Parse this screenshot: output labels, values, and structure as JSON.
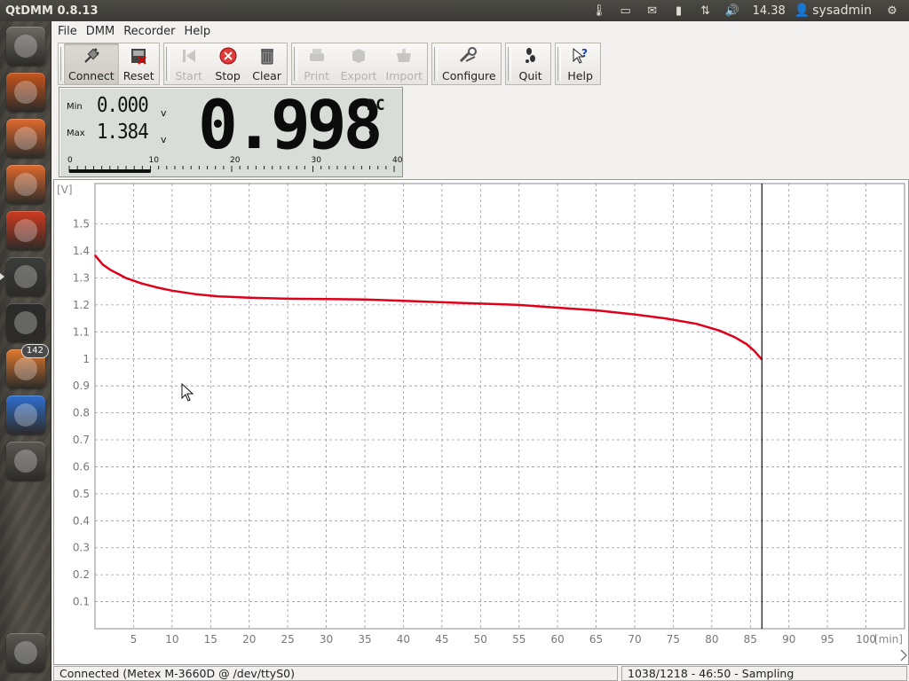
{
  "topbar": {
    "app_title": "QtDMM 0.8.13",
    "clock": "14.38",
    "user": "sysadmin"
  },
  "launcher": {
    "items": [
      {
        "name": "dash-home",
        "color": "#6d6a63"
      },
      {
        "name": "firefox",
        "color": "#c8551c"
      },
      {
        "name": "files",
        "color": "#e06a2d"
      },
      {
        "name": "software-center",
        "color": "#e06a2d"
      },
      {
        "name": "system-settings",
        "color": "#d03a1e"
      },
      {
        "name": "qtdmm",
        "color": "#3b3d3a"
      },
      {
        "name": "terminal",
        "color": "#2b2b2b"
      },
      {
        "name": "update-manager",
        "color": "#e0782d",
        "badge": "142"
      },
      {
        "name": "chromium",
        "color": "#2e6fd0"
      },
      {
        "name": "workspace-switcher",
        "color": "#5a5852"
      },
      {
        "name": "trash",
        "color": "#5a5852"
      }
    ]
  },
  "menu": [
    "File",
    "DMM",
    "Recorder",
    "Help"
  ],
  "toolbar": {
    "groups": [
      [
        {
          "label": "Connect",
          "icon": "plug-icon",
          "state": "pressed"
        },
        {
          "label": "Reset",
          "icon": "reset-icon",
          "state": "normal"
        }
      ],
      [
        {
          "label": "Start",
          "icon": "start-icon",
          "state": "disabled"
        },
        {
          "label": "Stop",
          "icon": "stop-icon",
          "state": "normal"
        },
        {
          "label": "Clear",
          "icon": "trash-icon",
          "state": "normal"
        }
      ],
      [
        {
          "label": "Print",
          "icon": "print-icon",
          "state": "disabled"
        },
        {
          "label": "Export",
          "icon": "export-icon",
          "state": "disabled"
        },
        {
          "label": "Import",
          "icon": "import-icon",
          "state": "disabled"
        }
      ],
      [
        {
          "label": "Configure",
          "icon": "wrench-icon",
          "state": "normal"
        }
      ],
      [
        {
          "label": "Quit",
          "icon": "quit-icon",
          "state": "normal"
        }
      ],
      [
        {
          "label": "Help",
          "icon": "help-icon",
          "state": "normal"
        }
      ]
    ]
  },
  "display": {
    "min_label": "Min",
    "min_value": "0.000",
    "min_unit": "V",
    "max_label": "Max",
    "max_value": "1.384",
    "max_unit": "V",
    "value": "0.998",
    "mode": "DC",
    "unit": "V",
    "bar_scale": [
      "0",
      "10",
      "20",
      "30",
      "40"
    ],
    "bar_fill_fraction": 0.25
  },
  "chart_data": {
    "type": "line",
    "xlabel": "[min]",
    "ylabel": "[V]",
    "xlim": [
      0,
      105
    ],
    "ylim": [
      0,
      1.65
    ],
    "x_ticks": [
      5,
      10,
      15,
      20,
      25,
      30,
      35,
      40,
      45,
      50,
      55,
      60,
      65,
      70,
      75,
      80,
      85,
      90,
      95,
      100
    ],
    "y_ticks": [
      0.1,
      0.2,
      0.3,
      0.4,
      0.5,
      0.6,
      0.7,
      0.8,
      0.9,
      1,
      1.1,
      1.2,
      1.3,
      1.4,
      1.5
    ],
    "grid": true,
    "cursor_x": 86.5,
    "series": [
      {
        "color": "#e0001a",
        "x": [
          0,
          1,
          2,
          3,
          4,
          6,
          8,
          10,
          13,
          16,
          20,
          25,
          30,
          35,
          40,
          45,
          50,
          55,
          60,
          65,
          70,
          74,
          78,
          81,
          83,
          84.5,
          85.5,
          86.5
        ],
        "y": [
          1.384,
          1.35,
          1.33,
          1.315,
          1.3,
          1.28,
          1.265,
          1.253,
          1.24,
          1.232,
          1.227,
          1.223,
          1.222,
          1.22,
          1.215,
          1.21,
          1.205,
          1.2,
          1.19,
          1.18,
          1.165,
          1.15,
          1.13,
          1.105,
          1.08,
          1.055,
          1.03,
          0.998
        ]
      }
    ]
  },
  "status": {
    "left": "Connected (Metex M-3660D @ /dev/ttyS0)",
    "right": "1038/1218 - 46:50 - Sampling"
  }
}
